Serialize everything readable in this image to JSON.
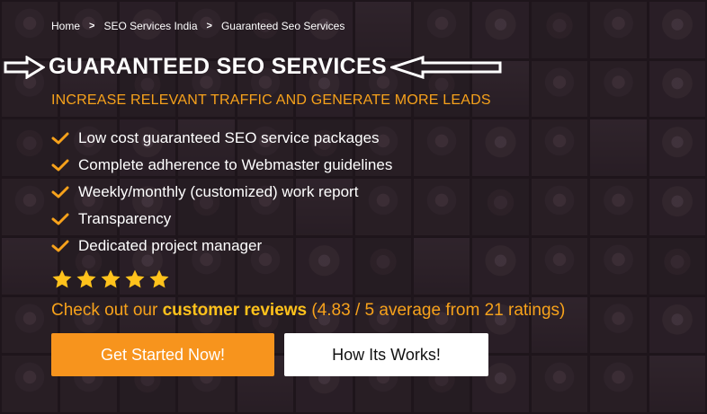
{
  "breadcrumb": {
    "items": [
      "Home",
      "SEO Services India",
      "Guaranteed Seo Services"
    ],
    "separator": ">"
  },
  "hero": {
    "title": "GUARANTEED SEO SERVICES",
    "subtitle": "INCREASE RELEVANT TRAFFIC AND GENERATE MORE LEADS"
  },
  "features": [
    "Low cost guaranteed SEO service packages",
    "Complete adherence to Webmaster guidelines",
    "Weekly/monthly (customized) work report",
    "Transparency",
    "Dedicated project manager"
  ],
  "rating": {
    "stars": 5,
    "prefix": "Check out our ",
    "link_text": "customer reviews",
    "suffix": " (4.83 / 5 average from 21 ratings)"
  },
  "buttons": {
    "primary": "Get Started Now!",
    "secondary": "How Its Works!"
  },
  "colors": {
    "accent": "#f7a21b",
    "primary_button": "#f7941d",
    "text": "#ffffff",
    "star": "#ffc21c"
  },
  "icons": {
    "check": "check-icon",
    "star": "star-icon",
    "arrow_right": "arrow-right-icon",
    "arrow_left": "arrow-left-icon"
  }
}
